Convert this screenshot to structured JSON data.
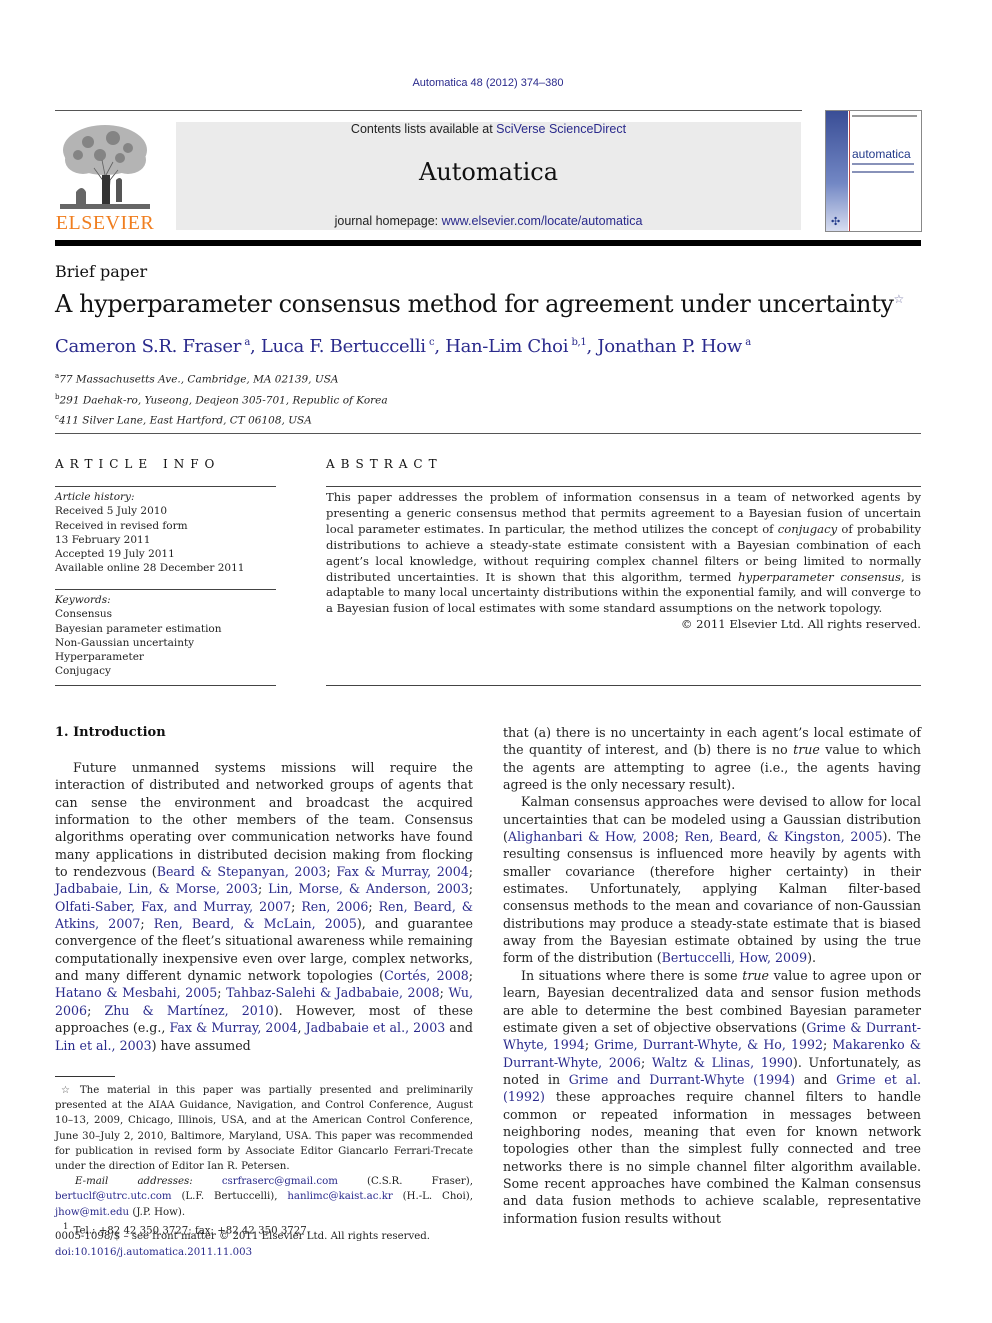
{
  "header": {
    "journal_ref": "Automatica 48 (2012) 374–380",
    "contents_prefix": "Contents lists available at ",
    "contents_link": "SciVerse ScienceDirect",
    "journal_title": "Automatica",
    "homepage_prefix": "journal homepage: ",
    "homepage_link": "www.elsevier.com/locate/automatica",
    "publisher_logo": "ELSEVIER",
    "cover_title": "automatica",
    "cover_ifac": "✣",
    "colors": {
      "link": "#2a2a8c",
      "elsevier_orange": "#f07e1f",
      "masthead_bg": "#ebebeb"
    }
  },
  "article": {
    "type": "Brief paper",
    "title": "A hyperparameter consensus method for agreement under uncertainty",
    "title_note": "☆",
    "authors": [
      {
        "name": "Cameron S.R. Fraser",
        "sup": "a"
      },
      {
        "name": "Luca F. Bertuccelli",
        "sup": "c"
      },
      {
        "name": "Han-Lim Choi",
        "sup": "b,1"
      },
      {
        "name": "Jonathan P. How",
        "sup": "a"
      }
    ],
    "affiliations": [
      {
        "key": "a",
        "text": "77 Massachusetts Ave., Cambridge, MA 02139, USA"
      },
      {
        "key": "b",
        "text": "291 Daehak-ro, Yuseong, Deajeon 305-701, Republic of Korea"
      },
      {
        "key": "c",
        "text": "411 Silver Lane, East Hartford, CT 06108, USA"
      }
    ]
  },
  "article_info": {
    "heading": "ARTICLE INFO",
    "history_label": "Article history:",
    "history": [
      "Received 5 July 2010",
      "Received in revised form",
      "13 February 2011",
      "Accepted 19 July 2011",
      "Available online 28 December 2011"
    ],
    "keywords_label": "Keywords:",
    "keywords": [
      "Consensus",
      "Bayesian parameter estimation",
      "Non-Gaussian uncertainty",
      "Hyperparameter",
      "Conjugacy"
    ]
  },
  "abstract": {
    "heading": "ABSTRACT",
    "p1": "This paper addresses the problem of information consensus in a team of networked agents by presenting a generic consensus method that permits agreement to a Bayesian fusion of uncertain local parameter estimates. In particular, the method utilizes the concept of ",
    "conjugacy": "conjugacy",
    "p2": " of probability distributions to achieve a steady-state estimate consistent with a Bayesian combination of each agent’s local knowledge, without requiring complex channel filters or being limited to normally distributed uncertainties. It is shown that this algorithm, termed ",
    "term": "hyperparameter consensus",
    "p3": ", is adaptable to many local uncertainty distributions within the exponential family, and will converge to a Bayesian fusion of local estimates with some standard assumptions on the network topology.",
    "copyright": "© 2011 Elsevier Ltd. All rights reserved."
  },
  "introduction": {
    "heading": "1.  Introduction",
    "left": {
      "t1": "Future unmanned systems missions will require the interaction of distributed and networked groups of agents that can sense the environment and broadcast the acquired information to the other members of the team. Consensus algorithms operating over communication networks have found many applications in distributed decision making from flocking to rendezvous (",
      "c1": "Beard & Stepanyan, 2003",
      "c2": "Fax & Murray, 2004",
      "c3": "Jadbabaie, Lin, & Morse, 2003",
      "c4": "Lin, Morse, & Anderson, 2003",
      "c5": "Olfati-Saber, Fax, and Murray, 2007",
      "c6": "Ren, 2006",
      "c7": "Ren, Beard, & Atkins, 2007",
      "c8": "Ren, Beard, & McLain, 2005",
      "t2": "), and guarantee convergence of the fleet’s situational awareness while remaining computationally inexpensive even over large, complex networks, and many different dynamic network topologies (",
      "c9": "Cortés, 2008",
      "c10": "Hatano & Mesbahi, 2005",
      "c11": "Tahbaz-Salehi & Jadbabaie, 2008",
      "c12": "Wu, 2006",
      "c13": "Zhu & Martínez, 2010",
      "t3": "). However, most of these approaches (e.g., ",
      "c14": "Fax & Murray, 2004",
      "c15": "Jadbabaie et al., 2003",
      "t4": " and ",
      "c16": "Lin et al., 2003",
      "t5": ") have assumed"
    },
    "right": {
      "p1a": "that (a) there is no uncertainty in each agent’s local estimate of the quantity of interest, and (b) there is no ",
      "p1_true": "true",
      "p1b": " value to which the agents are attempting to agree (i.e., the agents having agreed is the only necessary result).",
      "p2a": "Kalman consensus approaches were devised to allow for local uncertainties that can be modeled using a Gaussian distribution (",
      "p2_c1": "Alighanbari & How, 2008",
      "p2_c2": "Ren, Beard, & Kingston, 2005",
      "p2b": "). The resulting consensus is influenced more heavily by agents with smaller covariance (therefore higher certainty) in their estimates. Unfortunately, applying Kalman filter-based consensus methods to the mean and covariance of non-Gaussian distributions may produce a steady-state estimate that is biased away from the Bayesian estimate obtained by using the true form of the distribution (",
      "p2_c3": "Bertuccelli, How, 2009",
      "p2c": ").",
      "p3a": "In situations where there is some ",
      "p3_true": "true",
      "p3b": " value to agree upon or learn, Bayesian decentralized data and sensor fusion methods are able to determine the best combined Bayesian parameter estimate given a set of objective observations (",
      "p3_c1": "Grime & Durrant-Whyte, 1994",
      "p3_c2": "Grime, Durrant-Whyte, & Ho, 1992",
      "p3_c3": "Makarenko & Durrant-Whyte, 2006",
      "p3_c4": "Waltz & Llinas, 1990",
      "p3c": "). Unfortunately, as noted in ",
      "p3_c5": "Grime and Durrant-Whyte",
      "p3_c5y": "(1994)",
      "p3d": " and ",
      "p3_c6": "Grime et al.",
      "p3_c6y": "(1992)",
      "p3e": " these approaches require channel filters to handle common or repeated information in messages between neighboring nodes, meaning that even for known network topologies other than the simplest fully connected and tree networks there is no simple channel filter algorithm available. Some recent approaches have combined the Kalman consensus and data fusion methods to achieve scalable, representative information fusion results without"
    }
  },
  "footnotes": {
    "star_mark": "☆",
    "star_text": "The material in this paper was partially presented and preliminarily presented at the AIAA Guidance, Navigation, and Control Conference, August 10–13, 2009, Chicago, Illinois, USA, and at the American Control Conference, June 30–July 2, 2010, Baltimore, Maryland, USA. This paper was recommended for publication in revised form by Associate Editor Giancarlo Ferrari-Trecate under the direction of Editor Ian R. Petersen.",
    "email_label": "E-mail addresses:",
    "emails": [
      {
        "addr": "csrfraserc@gmail.com",
        "who": " (C.S.R. Fraser), "
      },
      {
        "addr": "bertuclf@utrc.utc.com",
        "who": " (L.F. Bertuccelli), "
      },
      {
        "addr": "hanlimc@kaist.ac.kr",
        "who": " (H.-L. Choi), "
      },
      {
        "addr": "jhow@mit.edu",
        "who": " (J.P. How)."
      }
    ],
    "fn1_mark": "1",
    "fn1_text": "Tel.: +82 42 350 3727; fax: +82 42 350 3727."
  },
  "front_matter": {
    "issn_line": "0005-1098/$ – see front matter © 2011 Elsevier Ltd. All rights reserved.",
    "doi": "doi:10.1016/j.automatica.2011.11.003"
  }
}
